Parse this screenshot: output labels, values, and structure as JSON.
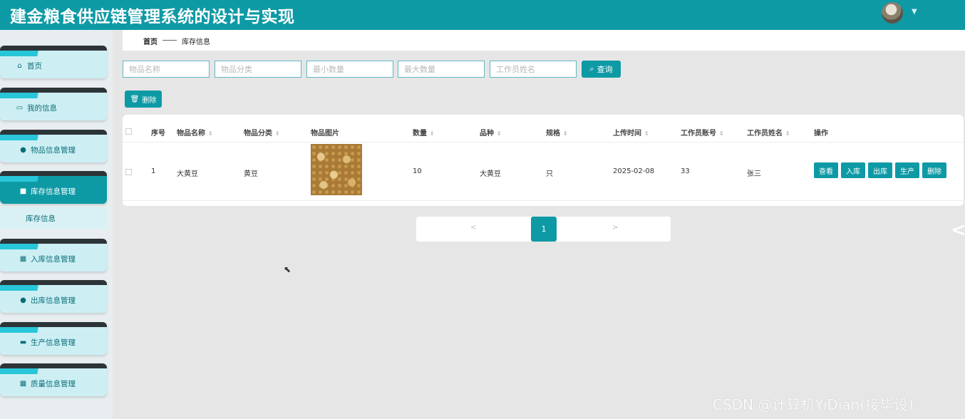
{
  "header": {
    "title": "建金粮食供应链管理系统的设计与实现"
  },
  "sidebar": {
    "items": [
      {
        "label": "首页",
        "icon": "home-icon"
      },
      {
        "label": "我的信息",
        "icon": "card-icon"
      },
      {
        "label": "物品信息管理",
        "icon": "pin-icon"
      },
      {
        "label": "库存信息管理",
        "icon": "clipboard-icon"
      },
      {
        "label": "入库信息管理",
        "icon": "grid-icon"
      },
      {
        "label": "出库信息管理",
        "icon": "user-icon"
      },
      {
        "label": "生产信息管理",
        "icon": "briefcase-icon"
      },
      {
        "label": "质量信息管理",
        "icon": "grid-icon"
      }
    ],
    "submenu_label": "库存信息"
  },
  "breadcrumb": {
    "home": "首页",
    "current": "库存信息"
  },
  "search": {
    "item_name_placeholder": "物品名称",
    "item_category_placeholder": "物品分类",
    "min_qty_placeholder": "最小数量",
    "max_qty_placeholder": "最大数量",
    "worker_name_placeholder": "工作员姓名",
    "query_label": "查询"
  },
  "toolbar": {
    "delete_label": "删除"
  },
  "table": {
    "headers": [
      "序号",
      "物品名称",
      "物品分类",
      "物品图片",
      "数量",
      "品种",
      "规格",
      "上传时间",
      "工作员账号",
      "工作员姓名",
      "操作"
    ],
    "rows": [
      {
        "index": "1",
        "name": "大黄豆",
        "category": "黄豆",
        "qty": "10",
        "variety": "大黄豆",
        "spec": "只",
        "time": "2025-02-08",
        "account": "33",
        "worker": "张三"
      }
    ],
    "actions": [
      "查看",
      "入库",
      "出库",
      "生产",
      "删除"
    ]
  },
  "pager": {
    "prev": "<",
    "next": ">",
    "current": "1"
  },
  "watermark": "CSDN @计算机YiDian(接毕设)",
  "colors": {
    "primary": "#0e9aa5",
    "sidebar_bg": "#cdeff4",
    "sidebar_dark": "#2d3438"
  }
}
